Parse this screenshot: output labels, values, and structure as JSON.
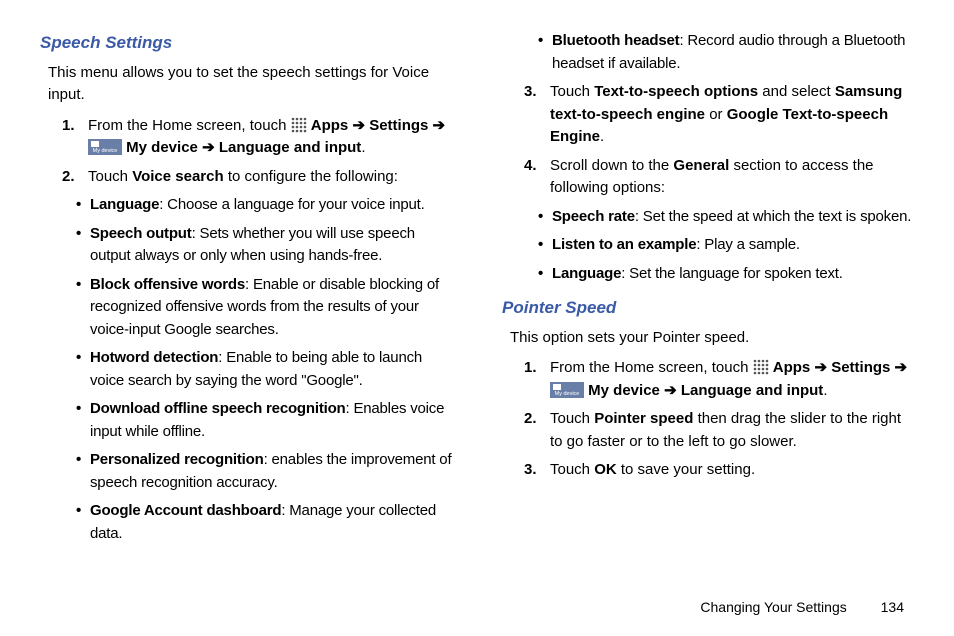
{
  "left": {
    "heading": "Speech Settings",
    "intro": "This menu allows you to set the speech settings for Voice input.",
    "step1_prefix": "From the Home screen, touch ",
    "apps": "Apps",
    "settings": "Settings",
    "mydevice": "My device",
    "langinput": "Language and input",
    "step2_prefix": "Touch ",
    "voice_search": "Voice search",
    "step2_suffix": " to configure the following:",
    "b_lang_t": "Language",
    "b_lang_d": ": Choose a language for your voice input.",
    "b_speech_t": "Speech output",
    "b_speech_d": ": Sets whether you will use speech output always or only when using hands-free.",
    "b_block_t": "Block offensive words",
    "b_block_d": ": Enable or disable blocking of recognized offensive words from the results of your voice-input Google searches.",
    "b_hot_t": "Hotword detection",
    "b_hot_d": ": Enable to being able to launch voice search by saying the word \"Google\".",
    "b_dl_t": "Download offline speech recognition",
    "b_dl_d": ": Enables voice input while offline.",
    "b_pers_t": "Personalized recognition",
    "b_pers_d": ": enables the improvement of speech recognition accuracy.",
    "b_goog_t": "Google Account dashboard",
    "b_goog_d": ": Manage your collected data."
  },
  "right": {
    "b_bt_t": "Bluetooth headset",
    "b_bt_d": ": Record audio through a Bluetooth headset if available.",
    "step3_prefix": "Touch ",
    "tts_opts": "Text-to-speech options",
    "step3_mid": " and select ",
    "samsung_tts": "Samsung text-to-speech engine",
    "or": " or ",
    "google_tts": "Google Text-to-speech Engine",
    "step4_prefix": "Scroll down to the ",
    "general": "General",
    "step4_suffix": " section to access the following options:",
    "b_rate_t": "Speech rate",
    "b_rate_d": ": Set the speed at which the text is spoken.",
    "b_listen_t": "Listen to an example",
    "b_listen_d": ": Play a sample.",
    "b_lang2_t": "Language",
    "b_lang2_d": ": Set the language for spoken text.",
    "ps_heading": "Pointer Speed",
    "ps_intro": "This option sets your Pointer speed.",
    "ps_step2_prefix": "Touch ",
    "pointer_speed": "Pointer speed",
    "ps_step2_suffix": " then drag the slider to the right to go faster or to the left to go slower.",
    "ps_step3_prefix": "Touch ",
    "ok": "OK",
    "ps_step3_suffix": " to save your setting."
  },
  "footer": {
    "section": "Changing Your Settings",
    "page": "134"
  },
  "nums": {
    "n1": "1.",
    "n2": "2.",
    "n3": "3.",
    "n4": "4."
  },
  "arrow": "➔",
  "period": ".",
  "bullet": "•",
  "mydevice_label": "My device"
}
